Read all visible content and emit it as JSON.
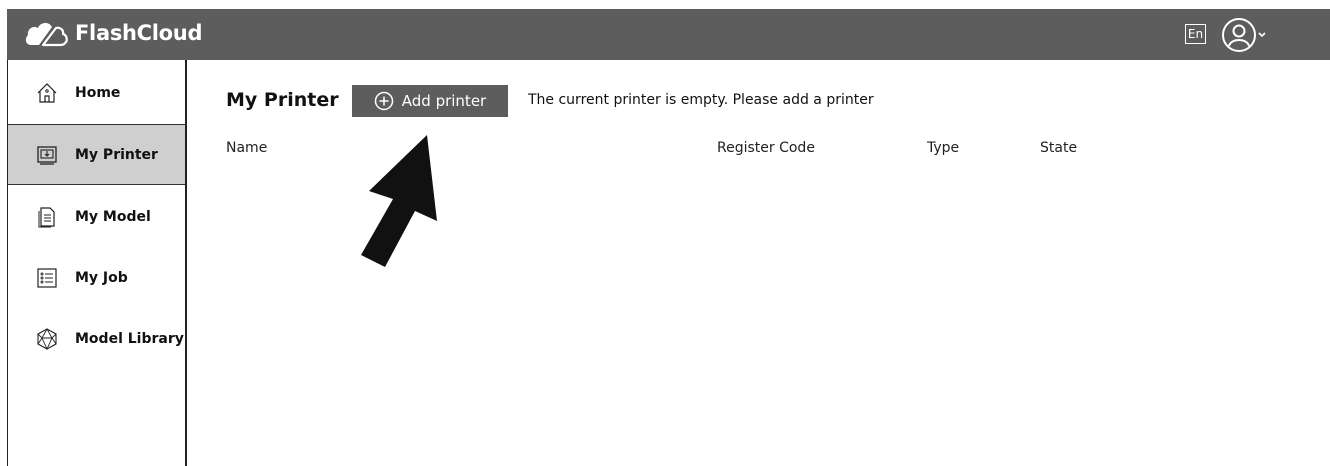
{
  "app": {
    "name": "FlashCloud"
  },
  "header": {
    "language_label": "En",
    "user_icon": "user-icon",
    "dropdown_icon": "chevron-down-icon"
  },
  "sidebar": {
    "items": [
      {
        "label": "Home",
        "icon": "house-icon",
        "active": false
      },
      {
        "label": "My Printer",
        "icon": "printer-icon",
        "active": true
      },
      {
        "label": "My Model",
        "icon": "document-icon",
        "active": false
      },
      {
        "label": "My Job",
        "icon": "checklist-icon",
        "active": false
      },
      {
        "label": "Model Library",
        "icon": "polyhedron-icon",
        "active": false
      }
    ]
  },
  "main": {
    "title": "My Printer",
    "add_button_label": "Add printer",
    "empty_message": "The current printer is empty. Please add a printer",
    "columns": [
      "Name",
      "Register Code",
      "Type",
      "State"
    ],
    "rows": []
  },
  "colors": {
    "topbar": "#5d5d5d",
    "active_nav": "#cfcfcf",
    "button": "#5d5d5d"
  }
}
